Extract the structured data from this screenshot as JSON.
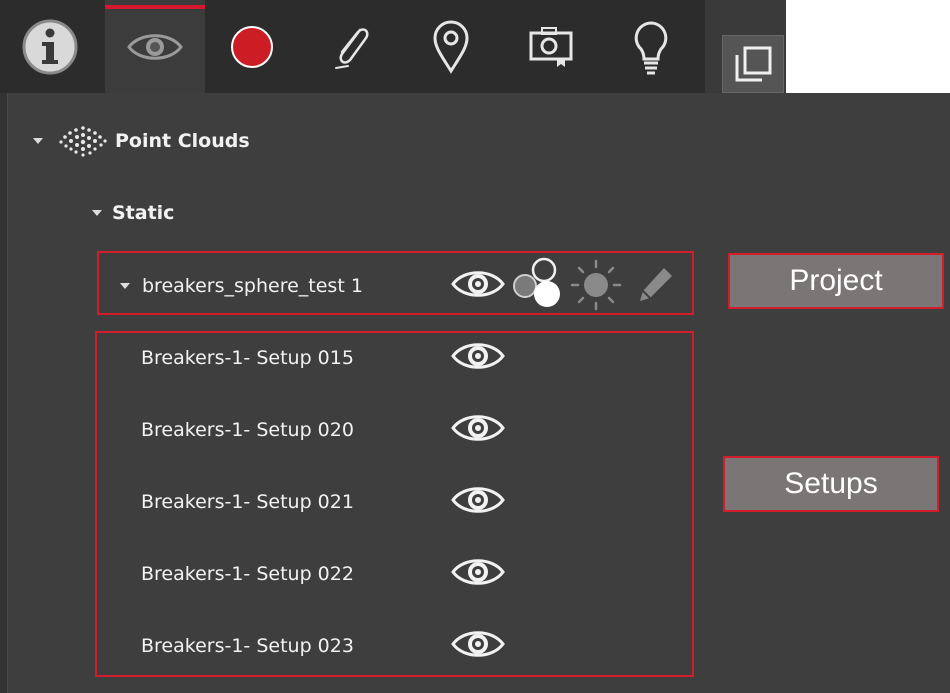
{
  "toolbar": {
    "tools": [
      {
        "id": "info",
        "icon": "info-icon"
      },
      {
        "id": "visibility",
        "icon": "eye-icon",
        "active": true
      },
      {
        "id": "record",
        "icon": "record-icon"
      },
      {
        "id": "attachment",
        "icon": "paperclip-icon"
      },
      {
        "id": "location",
        "icon": "map-pin-icon"
      },
      {
        "id": "snapshot",
        "icon": "camera-icon"
      },
      {
        "id": "ideas",
        "icon": "lightbulb-icon"
      }
    ],
    "pane_toggle_icon": "window-stack-icon"
  },
  "tree": {
    "root": {
      "label": "Point Clouds",
      "icon": "point-cloud-icon"
    },
    "group": {
      "label": "Static"
    },
    "project": {
      "label": "breakers_sphere_test 1",
      "actions": [
        "eye-icon",
        "color-mode-icon",
        "brightness-icon",
        "pencil-icon"
      ]
    },
    "setups": [
      {
        "label": "Breakers-1- Setup 015"
      },
      {
        "label": "Breakers-1- Setup 020"
      },
      {
        "label": "Breakers-1- Setup 021"
      },
      {
        "label": "Breakers-1- Setup 022"
      },
      {
        "label": "Breakers-1- Setup 023"
      }
    ]
  },
  "annotations": {
    "project_label": "Project",
    "setups_label": "Setups",
    "highlight_color": "#d21e2a"
  },
  "colors": {
    "accent_red": "#d6182c",
    "record_red": "#cc1d25",
    "panel_bg": "#3e3e3e",
    "toolbar_bg": "#2c2c2c"
  }
}
